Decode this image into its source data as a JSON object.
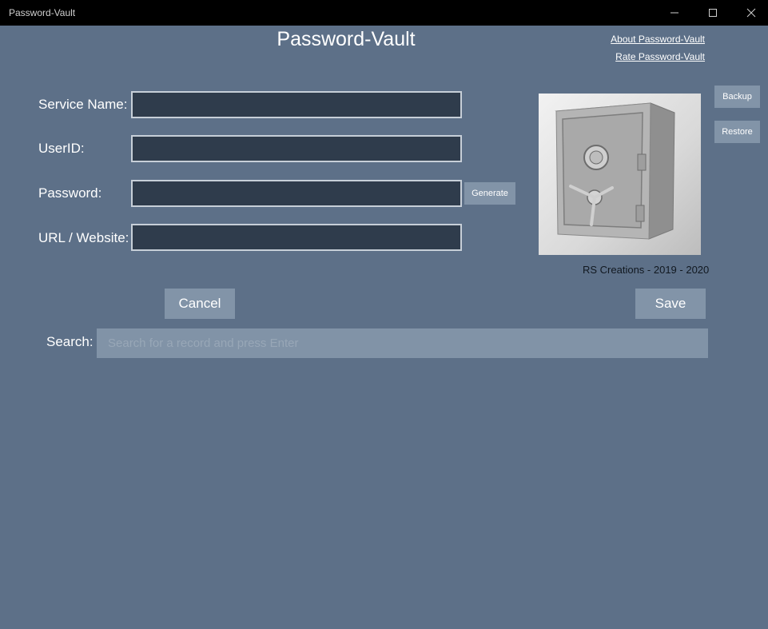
{
  "window": {
    "title": "Password-Vault",
    "controls": [
      "minimize",
      "maximize",
      "close"
    ]
  },
  "header": {
    "title": "Password-Vault",
    "links": {
      "about": "About Password-Vault",
      "rate": "Rate Password-Vault"
    }
  },
  "form": {
    "service_name": {
      "label": "Service Name:",
      "value": ""
    },
    "user_id": {
      "label": "UserID:",
      "value": ""
    },
    "password": {
      "label": "Password:",
      "value": ""
    },
    "url": {
      "label": "URL / Website:",
      "value": ""
    },
    "generate_label": "Generate"
  },
  "side_buttons": {
    "backup": "Backup",
    "restore": "Restore"
  },
  "image": {
    "icon": "safe-image",
    "caption": "RS Creations - 2019 - 2020"
  },
  "actions": {
    "cancel": "Cancel",
    "save": "Save"
  },
  "search": {
    "label": "Search:",
    "placeholder": "Search for a record and press Enter",
    "value": ""
  },
  "colors": {
    "background": "#5d7088",
    "titlebar": "#000000",
    "field_bg": "#2f3c4c",
    "button_bg": "#8294a8"
  }
}
